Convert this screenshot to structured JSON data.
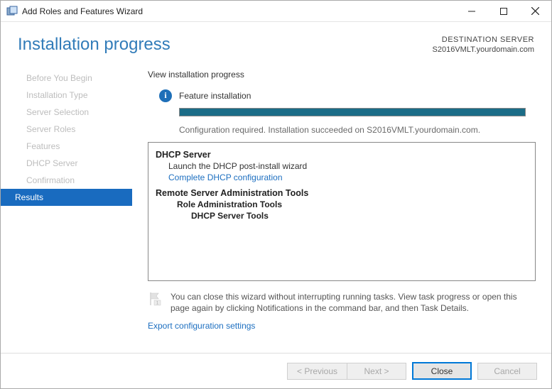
{
  "window": {
    "title": "Add Roles and Features Wizard"
  },
  "header": {
    "page_title": "Installation progress",
    "dest_label": "DESTINATION SERVER",
    "dest_server": "S2016VMLT.yourdomain.com"
  },
  "sidebar": {
    "items": [
      {
        "label": "Before You Begin"
      },
      {
        "label": "Installation Type"
      },
      {
        "label": "Server Selection"
      },
      {
        "label": "Server Roles"
      },
      {
        "label": "Features"
      },
      {
        "label": "DHCP Server"
      },
      {
        "label": "Confirmation"
      },
      {
        "label": "Results"
      }
    ]
  },
  "content": {
    "view_label": "View installation progress",
    "feature_line": "Feature installation",
    "status_text": "Configuration required. Installation succeeded on S2016VMLT.yourdomain.com.",
    "details": {
      "group1_title": "DHCP Server",
      "group1_line": "Launch the DHCP post-install wizard",
      "group1_link": "Complete DHCP configuration",
      "group2_title": "Remote Server Administration Tools",
      "group2_sub": "Role Administration Tools",
      "group2_leaf": "DHCP Server Tools"
    },
    "note": "You can close this wizard without interrupting running tasks. View task progress or open this page again by clicking Notifications in the command bar, and then Task Details.",
    "export_link": "Export configuration settings"
  },
  "footer": {
    "previous": "< Previous",
    "next": "Next >",
    "close": "Close",
    "cancel": "Cancel"
  }
}
